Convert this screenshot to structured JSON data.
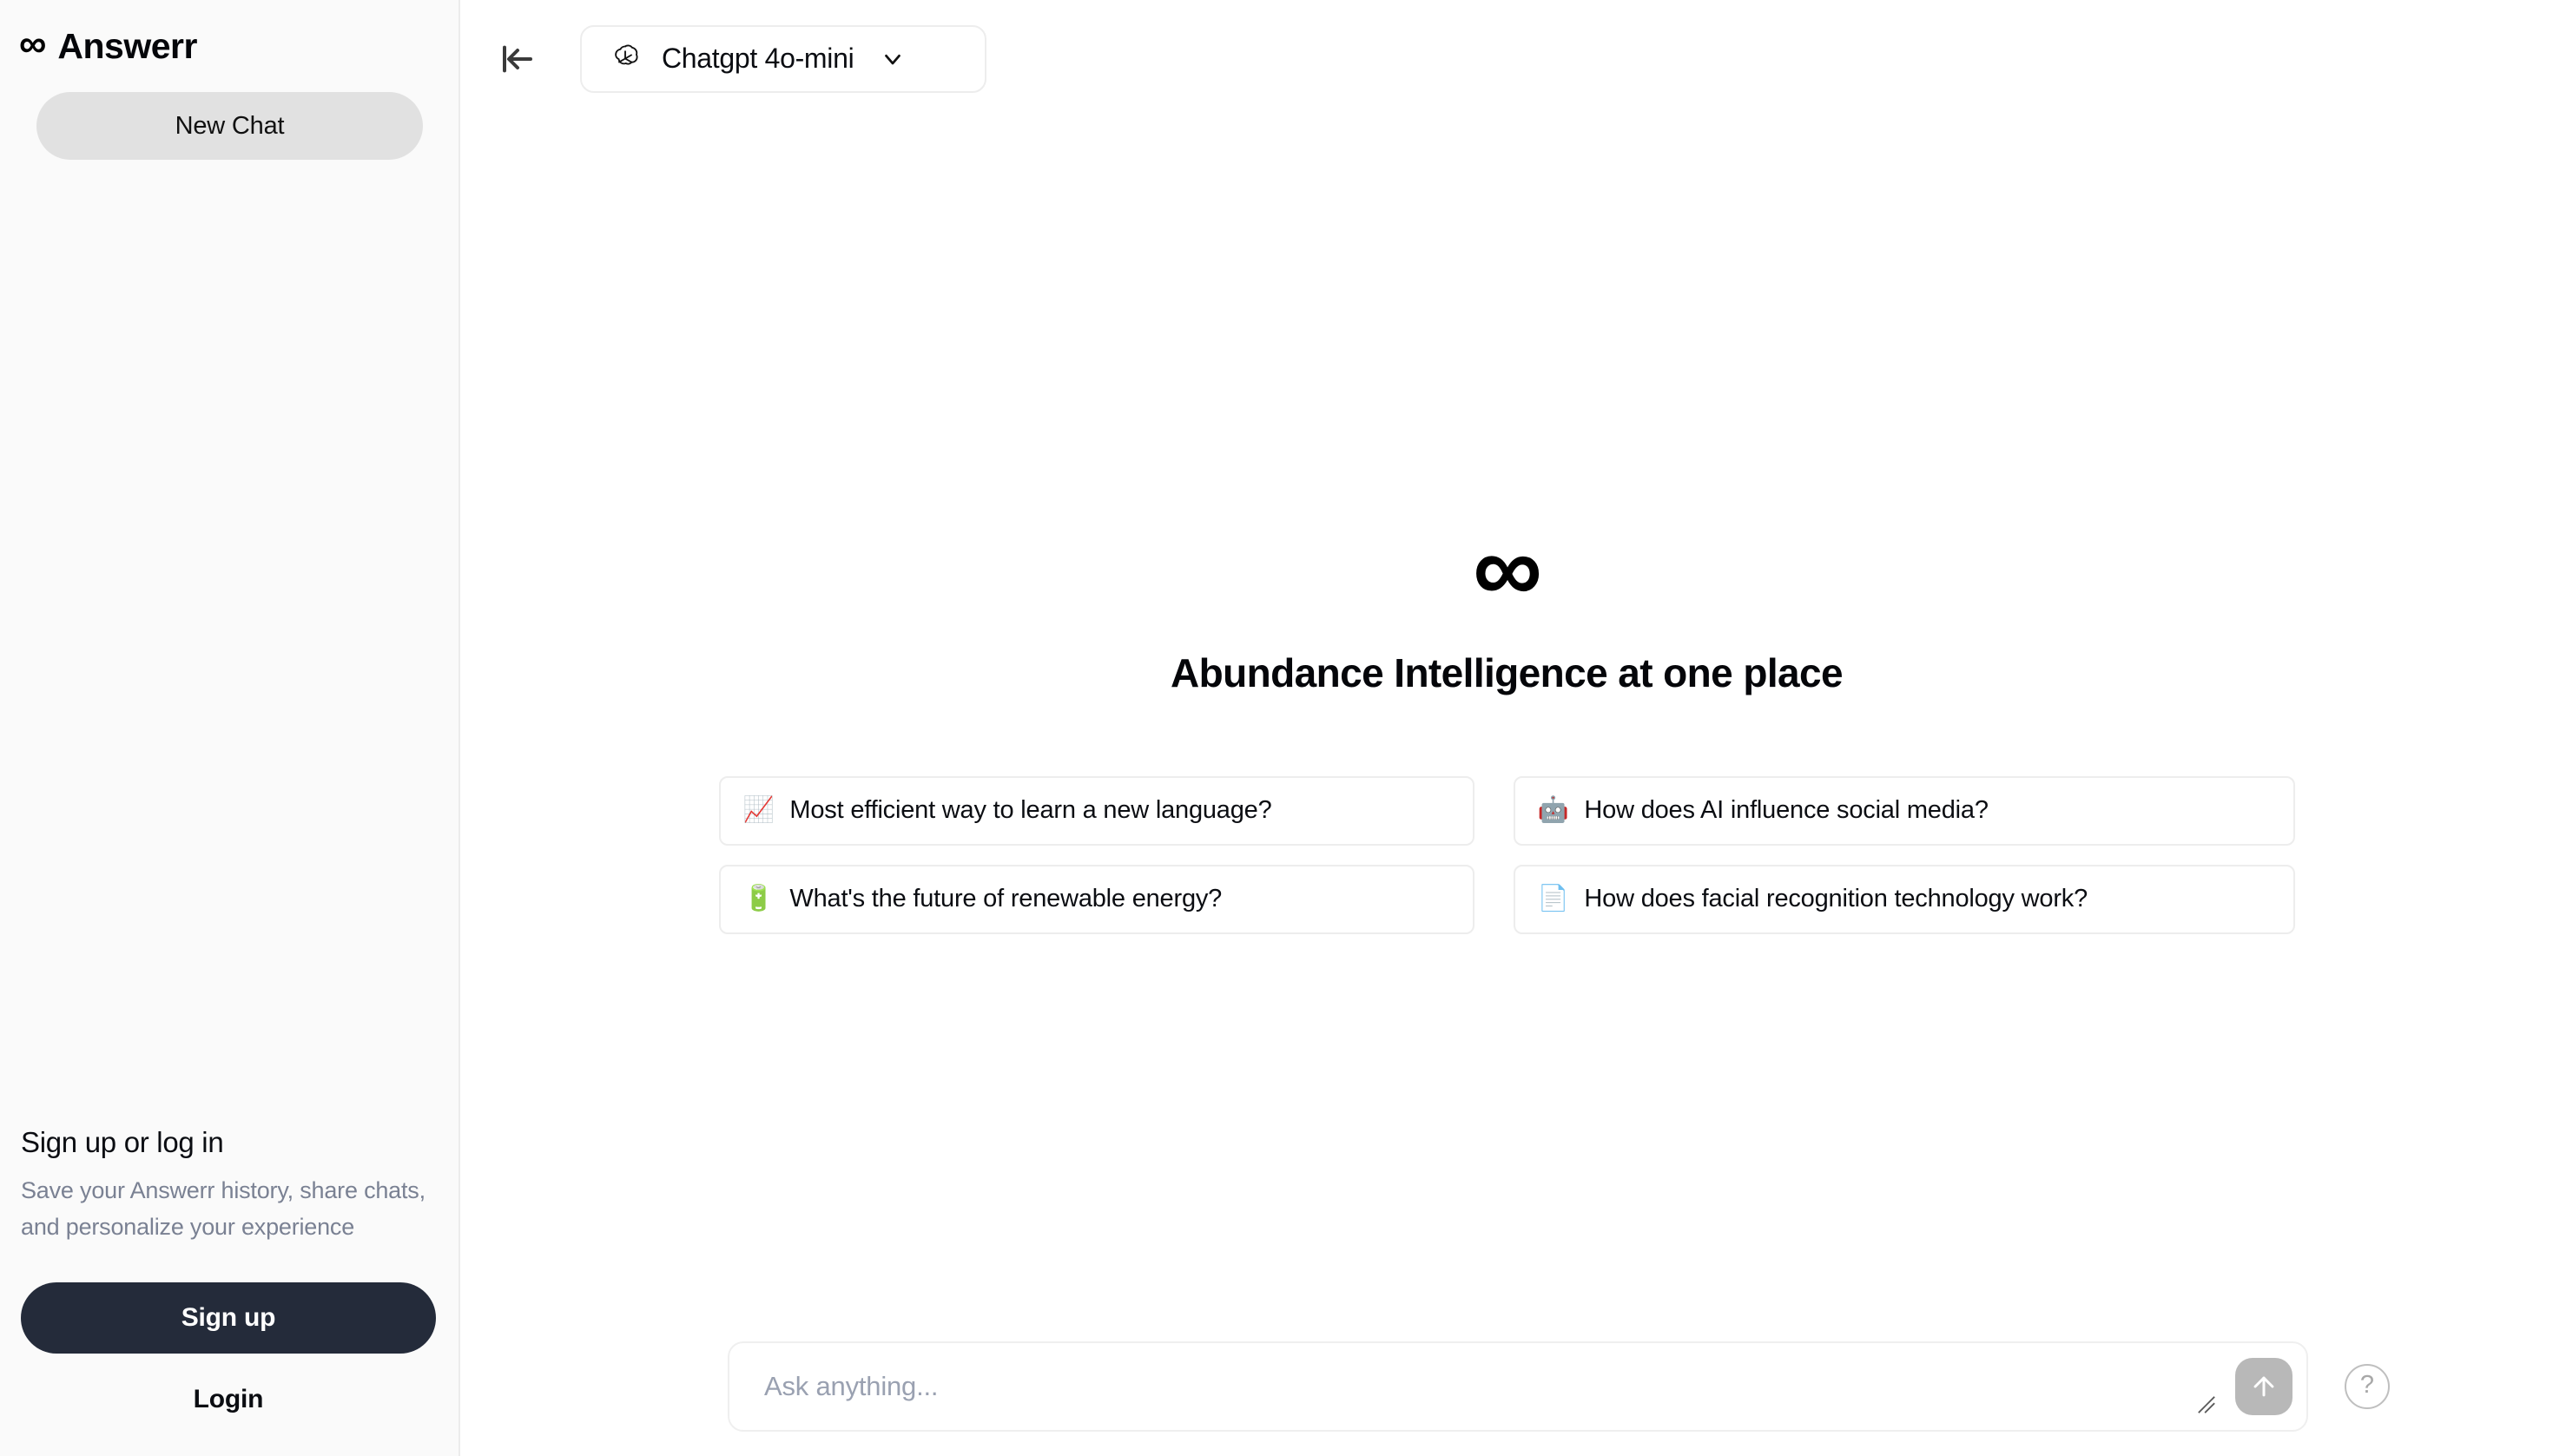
{
  "brand": {
    "logo_icon": "infinity-icon",
    "logo_glyph": "∞",
    "name": "Answerr"
  },
  "sidebar": {
    "new_chat_label": "New Chat",
    "auth": {
      "title": "Sign up or log in",
      "description": "Save your Answerr history, share chats, and personalize your experience",
      "signup_label": "Sign up",
      "login_label": "Login"
    }
  },
  "topbar": {
    "collapse_icon": "collapse-sidebar-icon",
    "model": {
      "icon": "openai-logo-icon",
      "name": "Chatgpt 4o-mini",
      "chevron_icon": "chevron-down-icon"
    }
  },
  "hero": {
    "logo_glyph": "∞",
    "title": "Abundance Intelligence at one place"
  },
  "suggestions": [
    {
      "emoji": "📈",
      "icon": "chart-increasing-icon",
      "text": "Most efficient way to learn a new language?"
    },
    {
      "emoji": "🤖",
      "icon": "robot-icon",
      "text": "How does AI influence social media?"
    },
    {
      "emoji": "🔋",
      "icon": "battery-icon",
      "text": "What's the future of renewable energy?"
    },
    {
      "emoji": "📄",
      "icon": "page-icon",
      "text": "How does facial recognition technology work?"
    }
  ],
  "composer": {
    "placeholder": "Ask anything...",
    "value": "",
    "send_icon": "arrow-up-icon",
    "resize_icon": "resize-handle-icon"
  },
  "help": {
    "label": "?",
    "icon": "question-mark-icon"
  },
  "colors": {
    "sidebar_bg": "#fafafa",
    "new_chat_bg": "#e1e1e1",
    "signup_bg": "#242b3a",
    "muted_text": "#7a8193",
    "send_bg": "#b8b8b8",
    "border": "#ededed"
  }
}
